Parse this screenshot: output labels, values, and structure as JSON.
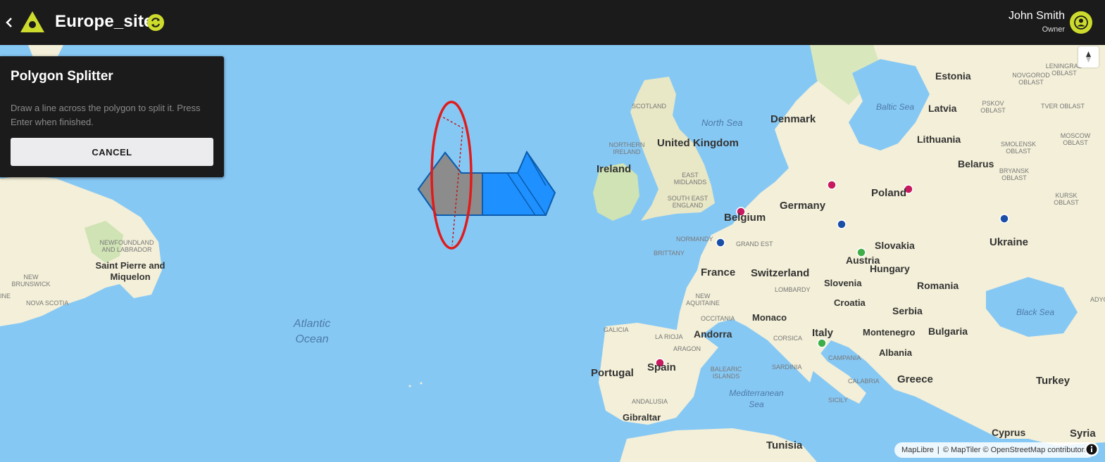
{
  "header": {
    "title": "Europe_sites",
    "back_icon": "chevron-left-icon",
    "logo_icon": "triangle-logo-icon",
    "sync_icon": "sync-icon",
    "user_name": "John Smith",
    "user_role": "Owner",
    "avatar_icon": "person-icon",
    "accent_color": "#cddc2c"
  },
  "panel": {
    "title": "Polygon Splitter",
    "description": "Draw a line across the polygon to split it. Press Enter when finished.",
    "cancel_label": "CANCEL"
  },
  "map": {
    "countries": [
      "United Kingdom",
      "Ireland",
      "Denmark",
      "Estonia",
      "Latvia",
      "Lithuania",
      "Belarus",
      "Poland",
      "Germany",
      "Belgium",
      "France",
      "Switzerland",
      "Austria",
      "Slovakia",
      "Hungary",
      "Ukraine",
      "Romania",
      "Slovenia",
      "Croatia",
      "Serbia",
      "Bulgaria",
      "Montenegro",
      "Albania",
      "Italy",
      "Monaco",
      "Andorra",
      "Spain",
      "Portugal",
      "Greece",
      "Turkey",
      "Cyprus",
      "Syria",
      "Tunisia",
      "Gibraltar"
    ],
    "regions": [
      "LENINGRAD OBLAST",
      "NOVGOROD OBLAST",
      "PSKOV OBLAST",
      "TVER OBLAST",
      "SMOLENSK OBLAST",
      "MOSCOW OBLAST",
      "BRYANSK OBLAST",
      "KURSK OBLAST",
      "ADYGE",
      "SCOTLAND",
      "NORTHERN IRELAND",
      "EAST MIDLANDS",
      "SOUTH EAST ENGLAND",
      "NORMANDY",
      "GRAND EST",
      "BRITTANY",
      "NEW AQUITAINE",
      "OCCITANIA",
      "LOMBARDY",
      "CORSICA",
      "SARDINIA",
      "CAMPANIA",
      "CALABRIA",
      "SICILY",
      "GALICIA",
      "LA RIOJA",
      "ARAGON",
      "BALEARIC ISLANDS",
      "ANDALUSIA",
      "NEWFOUNDLAND AND LABRADOR",
      "NEW BRUNSWICK",
      "NOVA SCOTIA",
      "INE"
    ],
    "waters": [
      "North Sea",
      "Baltic Sea",
      "Atlantic Ocean",
      "Mediterranean Sea",
      "Black Sea"
    ],
    "territories": [
      "Saint Pierre and Miquelon"
    ],
    "sea_color": "#86c8f4",
    "land_color": "#f3efd8",
    "polygon_fill_color": "#1e90ff",
    "selected_fill_color": "#8c8c8c",
    "highlight_color": "#e01b1b",
    "marker_colors": {
      "magenta": "#c8185e",
      "blue": "#1a4fa8",
      "green": "#3fae49"
    }
  },
  "controls": {
    "compass_icon": "compass-north-icon",
    "attribution_maplibre": "MapLibre",
    "attribution_maptiler": "© MapTiler",
    "attribution_osm": "© OpenStreetMap contributors",
    "attribution_separator": "|",
    "info_icon": "info-icon"
  }
}
